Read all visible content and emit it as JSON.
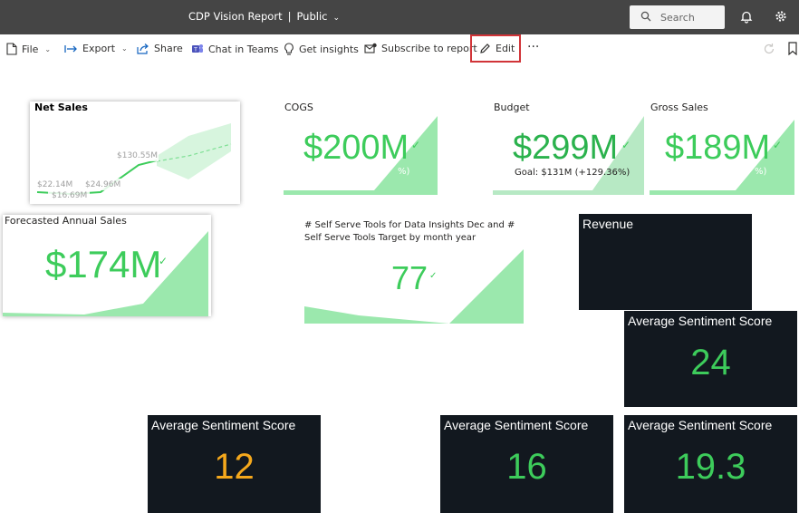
{
  "app": {
    "report_name": "CDP Vision Report",
    "visibility": "Public",
    "search_placeholder": "Search"
  },
  "toolbar": {
    "file": "File",
    "export": "Export",
    "share": "Share",
    "chat": "Chat in Teams",
    "insights": "Get insights",
    "subscribe": "Subscribe to report",
    "edit": "Edit",
    "more": "···"
  },
  "tiles": {
    "net_sales": {
      "title": "Net Sales",
      "labels": [
        "$130.55M",
        "$22.14M",
        "$24.96M",
        "$16.69M"
      ]
    },
    "cogs": {
      "title": "COGS",
      "value": "$200M",
      "partial": "%)"
    },
    "budget": {
      "title": "Budget",
      "value": "$299M",
      "goal": "Goal: $131M (+129.36%)"
    },
    "gross_sales": {
      "title": "Gross Sales",
      "value": "$189M",
      "partial": "%)"
    },
    "forecast": {
      "title": "Forecasted Annual Sales",
      "value": "$174M",
      "partial": ")"
    },
    "self_serve": {
      "title_line1": "# Self Serve Tools for Data Insights Dec and #",
      "title_line2": "Self Serve Tools Target by month year",
      "value": "77"
    },
    "revenue": {
      "title": "Revenue"
    },
    "sentiment_1": {
      "title": "Average Sentiment Score",
      "value": "24"
    },
    "sentiment_2": {
      "title": "Average Sentiment Score",
      "value": "12"
    },
    "sentiment_3": {
      "title": "Average Sentiment Score",
      "value": "16"
    },
    "sentiment_4": {
      "title": "Average Sentiment Score",
      "value": "19.3"
    }
  },
  "colors": {
    "topbar": "#454545",
    "kpi_green": "#3dcc5b",
    "area_green": "#9be8ad",
    "dark_tile": "#12181f",
    "warning_yellow": "#f5a81c",
    "highlight_red": "#d13438"
  }
}
